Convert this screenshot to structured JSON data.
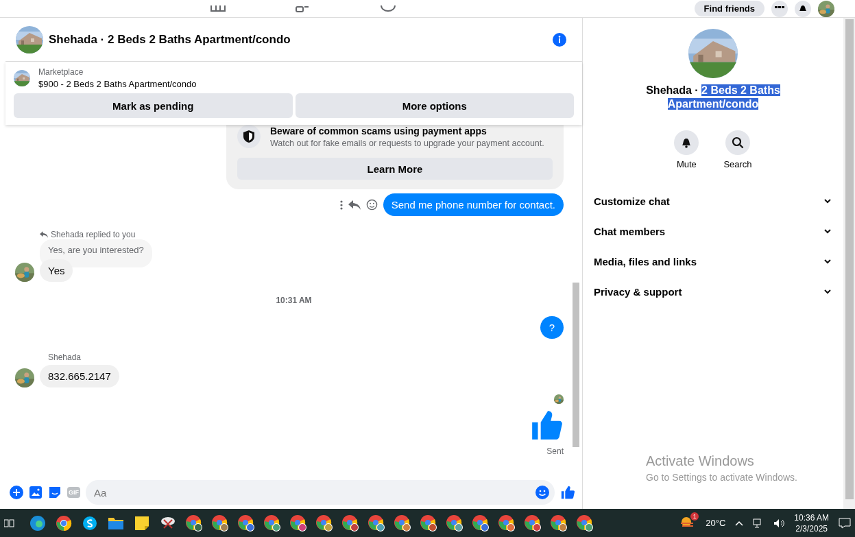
{
  "top_bar": {
    "find_friends": "Find friends"
  },
  "chat": {
    "title": "Shehada · 2 Beds 2 Baths Apartment/condo",
    "listing": {
      "source": "Marketplace",
      "title": "$900 - 2 Beds 2 Baths Apartment/condo",
      "buttons": [
        "Mark as pending",
        "More options"
      ]
    },
    "notice": {
      "title": "Beware of common scams using payment apps",
      "body": "Watch out for fake emails or requests to upgrade your payment account.",
      "button": "Learn More"
    },
    "messages": [
      {
        "kind": "outgoing",
        "text": "Send me phone number for contact.",
        "actions": true
      },
      {
        "kind": "reply",
        "label": "Shehada replied to you",
        "quote": "Yes, are you interested?",
        "text": "Yes"
      },
      {
        "kind": "time",
        "text": "10:31 AM"
      },
      {
        "kind": "outgoing",
        "text": "?",
        "actions": false
      },
      {
        "kind": "incoming",
        "sender": "Shehada",
        "text": "832.665.2147"
      },
      {
        "kind": "like",
        "status": "Sent"
      }
    ],
    "composer": {
      "placeholder": "Aa",
      "gif": "GIF"
    }
  },
  "details": {
    "name": "Shehada · ",
    "name_selected": "2 Beds 2 Baths Apartment/condo",
    "actions": [
      {
        "kind": "bell",
        "label": "Mute"
      },
      {
        "kind": "search",
        "label": "Search"
      }
    ],
    "sections": [
      {
        "label": "Customize chat",
        "expanded": false
      },
      {
        "label": "Chat members",
        "expanded": false
      },
      {
        "label": "Media, files and links",
        "expanded": false
      },
      {
        "label": "Privacy & support",
        "expanded": false
      }
    ],
    "activation": {
      "title": "Activate Windows",
      "body": "Go to Settings to activate Windows."
    }
  },
  "taskbar": {
    "apps": [
      {
        "kind": "edge"
      },
      {
        "kind": "chrome"
      },
      {
        "kind": "skype"
      },
      {
        "kind": "folder"
      },
      {
        "kind": "notes"
      },
      {
        "kind": "snip"
      },
      {
        "kind": "profile",
        "color": "#3b6b4a"
      },
      {
        "kind": "profile",
        "color": "#a08050"
      },
      {
        "kind": "profile",
        "color": "#3a6fd8"
      },
      {
        "kind": "profile",
        "color": "#4aa37a"
      },
      {
        "kind": "profile",
        "color": "#d0407a"
      },
      {
        "kind": "profile",
        "color": "#c0a040"
      },
      {
        "kind": "profile",
        "color": "#c04040"
      },
      {
        "kind": "profile",
        "color": "#50a0b0"
      },
      {
        "kind": "profile",
        "color": "#d08040"
      },
      {
        "kind": "profile",
        "color": "#c05030"
      },
      {
        "kind": "profile",
        "color": "#60a0a0"
      },
      {
        "kind": "profile",
        "color": "#3a6fd8"
      },
      {
        "kind": "profile",
        "color": "#e07040"
      },
      {
        "kind": "profile",
        "color": "#d04040"
      },
      {
        "kind": "profile",
        "color": "#c08040"
      },
      {
        "kind": "profile",
        "color": "#50a070"
      }
    ],
    "weather_badge": "1",
    "temperature": "20°C",
    "time": "10:36 AM",
    "date": "2/3/2025"
  }
}
